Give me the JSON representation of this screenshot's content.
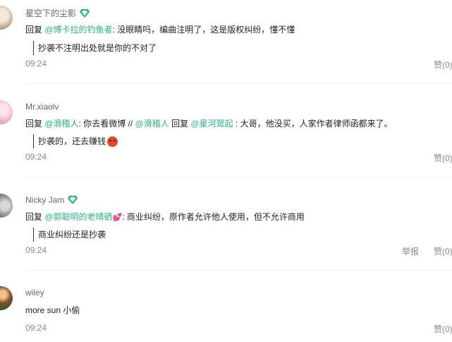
{
  "comments": [
    {
      "username": "星空下的尘影",
      "badge": "vip-badge-icon",
      "reply_prefix": "回复 ",
      "mention1": "@博卡拉的钓鱼者",
      "text1": ": 没眼睛吗，编曲注明了，这是版权纠纷，懂不懂",
      "quote": "抄袭不注明出处就是你的不对了",
      "time": "09:24",
      "like": "赞(0)"
    },
    {
      "username": "Mr.xiaolv",
      "reply_prefix": "回复 ",
      "mention1": "@滑稽人",
      "text1": ": 你去看微博 // ",
      "mention2": "@滑稽人",
      "text2": " 回复 ",
      "mention3": "@星河鹭起",
      "text3": " : 大哥，他没买，人家作者律师函都来了。",
      "quote": "抄袭的，还去赚钱",
      "time": "09:24",
      "like": "赞(0)"
    },
    {
      "username": "Nicky Jam",
      "badge": "vip-badge-icon",
      "reply_prefix": "回复 ",
      "mention1": "@郭聪明的老晴硒",
      "text1": ": 商业纠纷，原作者允许他人使用，但不允许商用",
      "quote": "商业纠纷还是抄袭",
      "time": "09:24",
      "report": "举报",
      "like": "赞(0)"
    },
    {
      "username": "wiley",
      "text1": "more sun 小偷",
      "time": "09:24",
      "like": "赞(0)"
    }
  ],
  "colors": {
    "mention": "#2bb37f",
    "muted": "#888888",
    "divider": "#efefef"
  }
}
